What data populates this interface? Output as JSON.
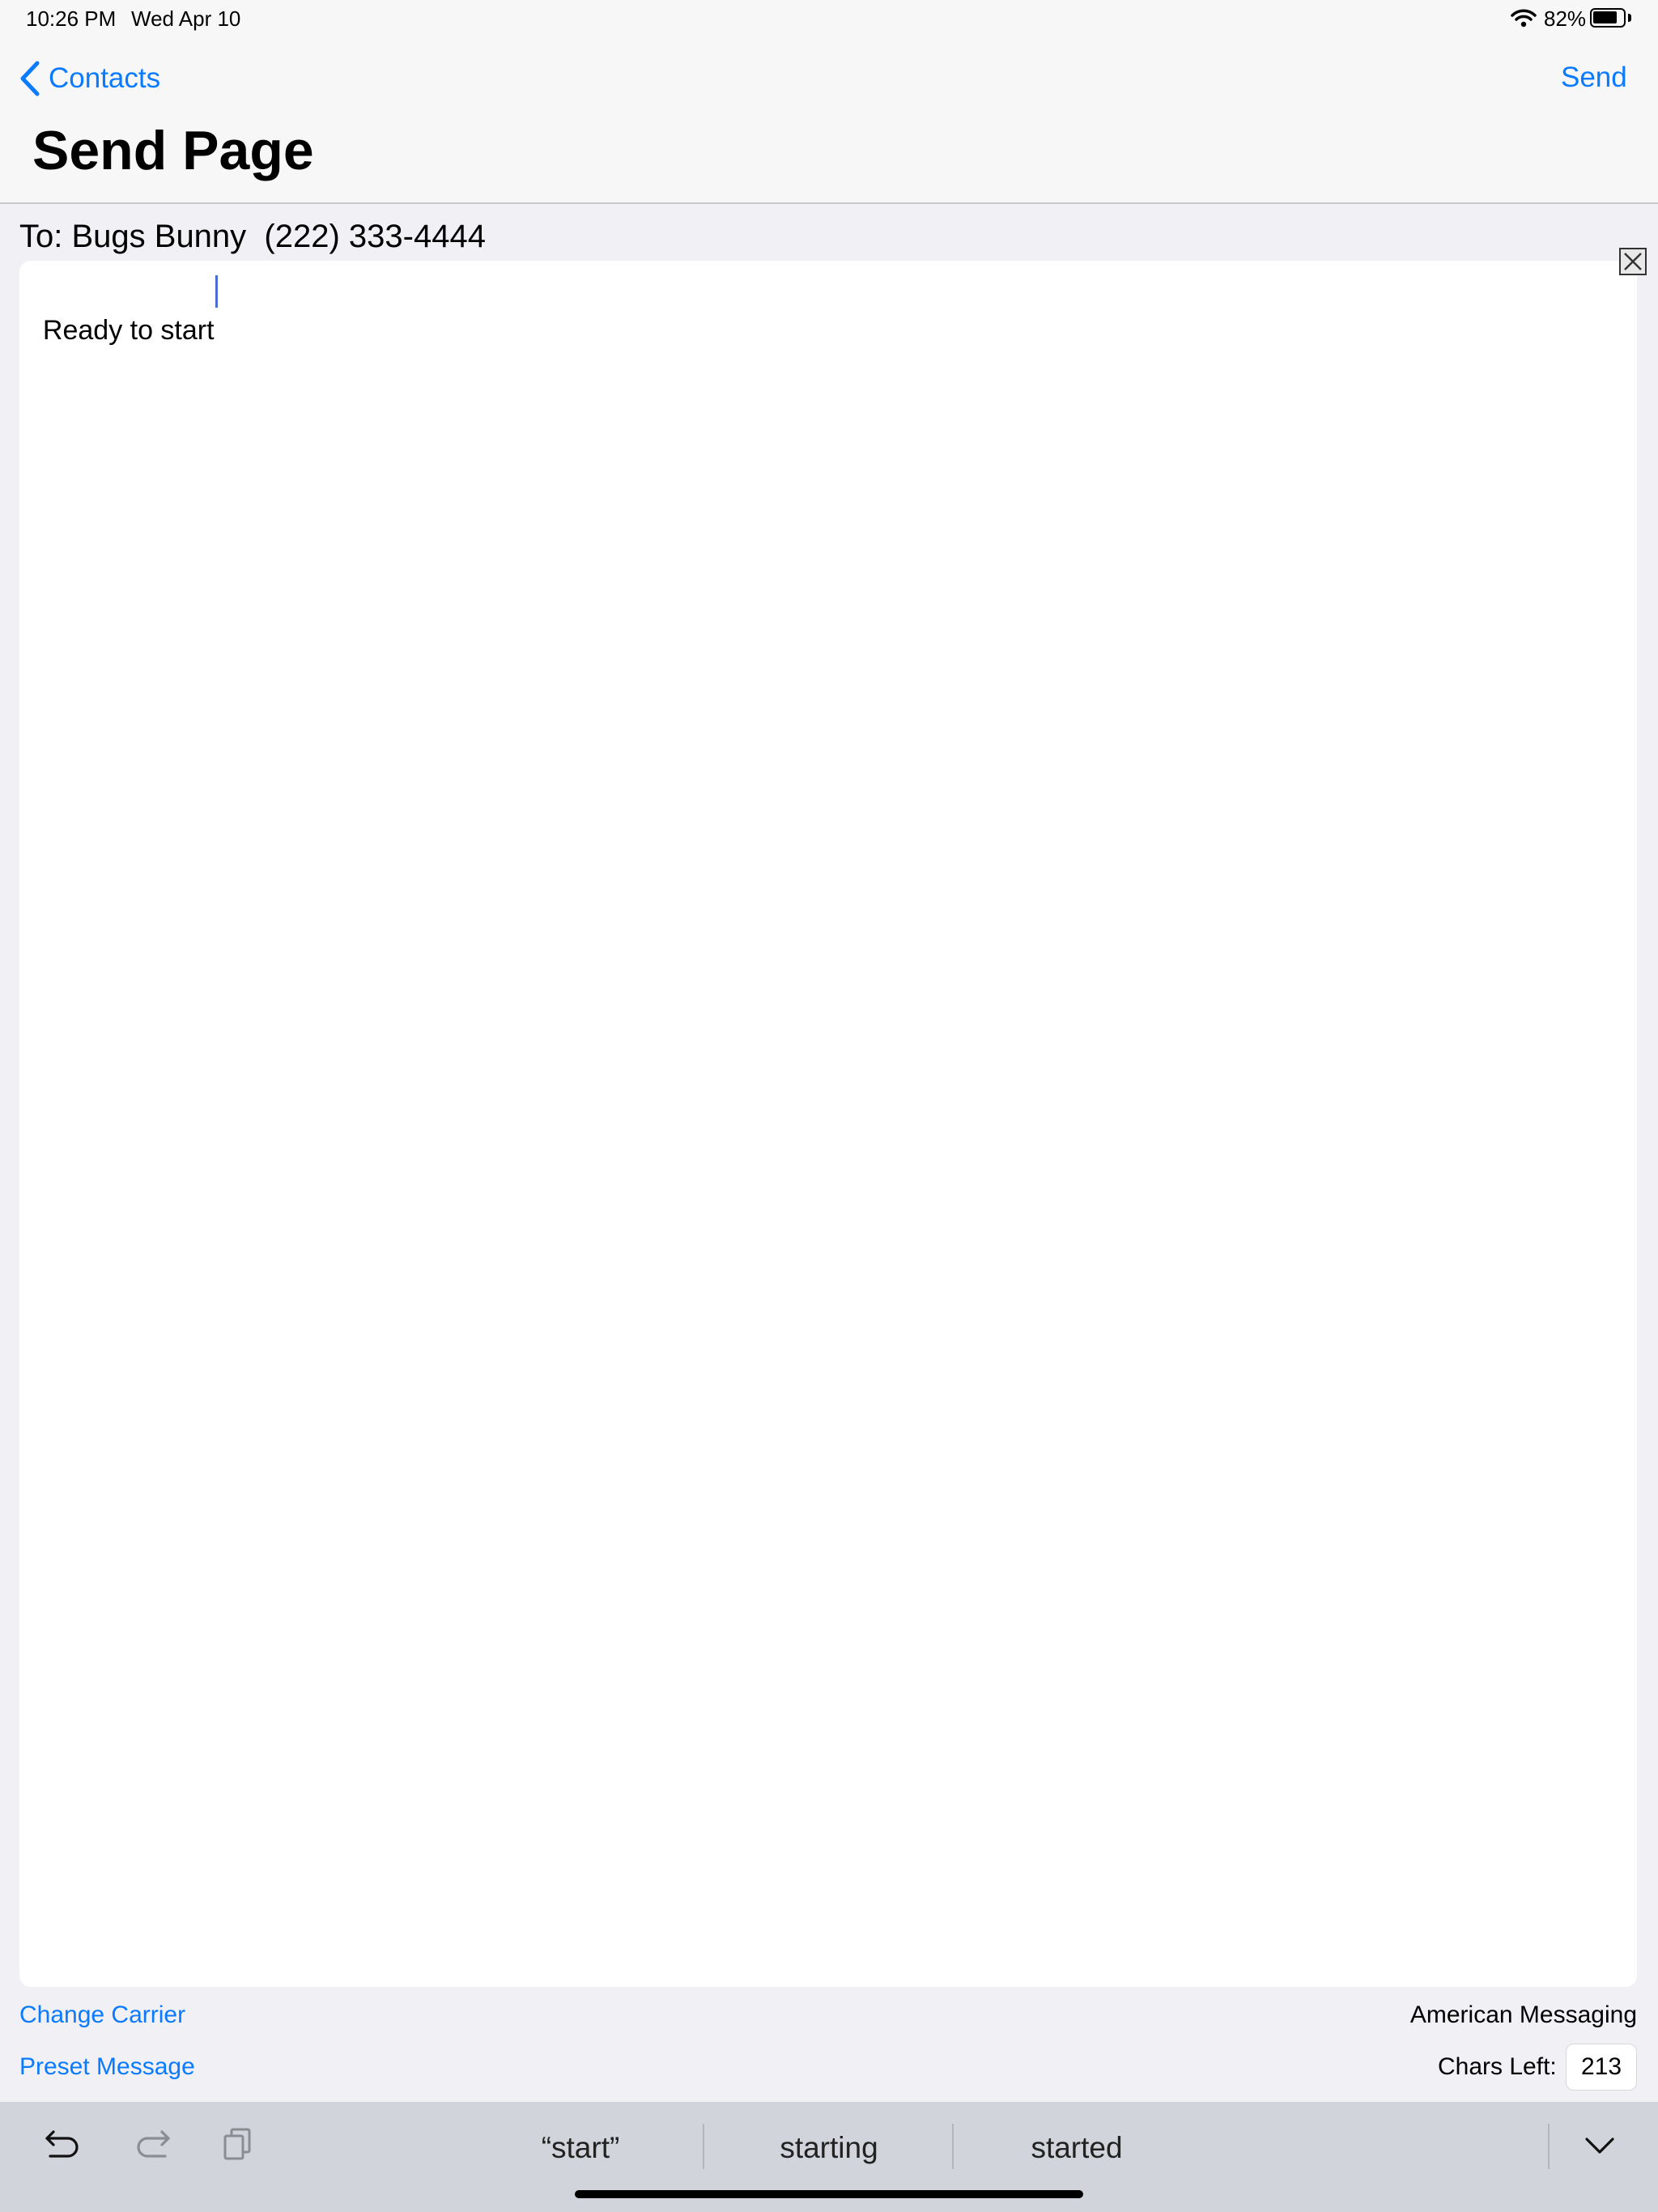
{
  "status_bar": {
    "time": "10:26 PM",
    "date": "Wed Apr 10",
    "battery_percent": "82%",
    "battery_level": 0.82,
    "icons": [
      "wifi-icon",
      "battery-icon"
    ]
  },
  "nav": {
    "back_label": "Contacts",
    "send_label": "Send",
    "title": "Send Page"
  },
  "recipient": {
    "line": "To: Bugs Bunny  (222) 333-4444"
  },
  "message": {
    "text": "Ready to start"
  },
  "footer": {
    "change_carrier": "Change Carrier",
    "carrier_name": "American Messaging",
    "preset_message": "Preset Message",
    "chars_left_label": "Chars Left:",
    "chars_left_value": "213"
  },
  "keyboard_bar": {
    "icons": [
      "undo-icon",
      "redo-icon",
      "paste-icon",
      "dismiss-keyboard-icon"
    ],
    "suggestions": [
      "“start”",
      "starting",
      "started"
    ]
  },
  "colors": {
    "accent": "#0a7aff",
    "background": "#f0f0f5",
    "keyboard_bar": "#d1d4da"
  }
}
